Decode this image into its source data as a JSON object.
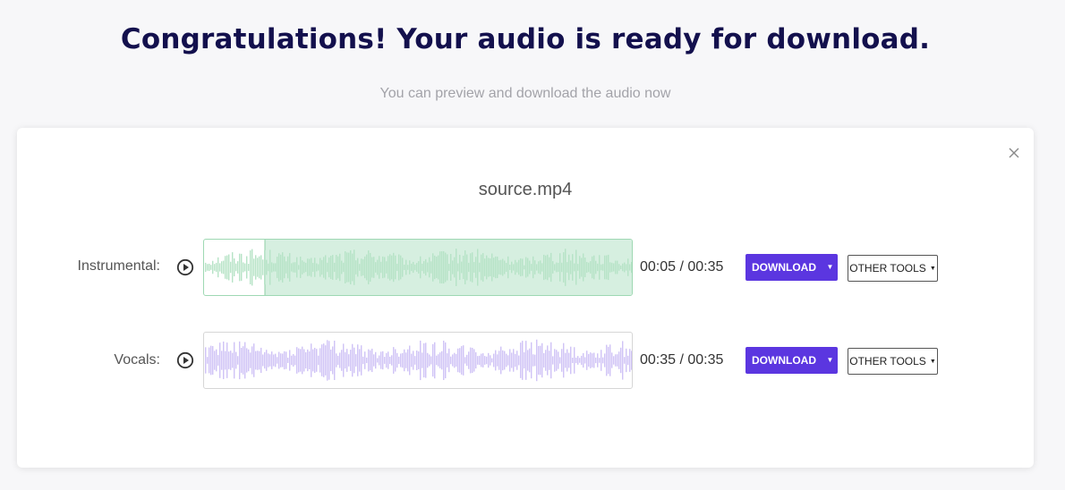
{
  "header": {
    "title": "Congratulations! Your audio is ready for download.",
    "subtitle": "You can preview and download the audio now"
  },
  "result": {
    "filename": "source.mp4",
    "close_icon": "close-icon",
    "tracks": [
      {
        "label": "Instrumental",
        "separator": ":",
        "time": "00:05 / 00:35",
        "progress": 0.143,
        "wave_color": "#b6e3c6",
        "highlight_color": "#d6efe0",
        "download_label": "DOWNLOAD",
        "tools_label": "OTHER TOOLS"
      },
      {
        "label": "Vocals",
        "separator": ":",
        "time": "00:35 / 00:35",
        "progress": 1.0,
        "wave_color": "#cfc3f6",
        "highlight_color": "#ffffff",
        "download_label": "DOWNLOAD",
        "tools_label": "OTHER TOOLS"
      }
    ]
  },
  "colors": {
    "accent": "#5b36e0",
    "title": "#13104d"
  }
}
